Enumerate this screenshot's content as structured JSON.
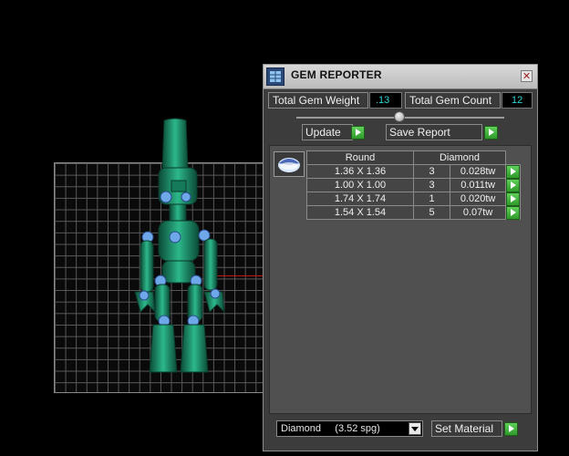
{
  "panel": {
    "title": "GEM REPORTER",
    "close_symbol": "✕",
    "total_weight_label": "Total Gem Weight",
    "total_weight_value": ".13",
    "total_count_label": "Total Gem Count",
    "total_count_value": "12",
    "update_label": "Update",
    "save_report_label": "Save Report",
    "material_select": "Diamond     (3.52 spg)",
    "set_material_label": "Set Material"
  },
  "table": {
    "headers": [
      "Round",
      "Diamond"
    ],
    "rows": [
      {
        "size": "1.36 X 1.36",
        "count": "3",
        "weight": "0.028tw"
      },
      {
        "size": "1.00 X 1.00",
        "count": "3",
        "weight": "0.011tw"
      },
      {
        "size": "1.74 X 1.74",
        "count": "1",
        "weight": "0.020tw"
      },
      {
        "size": "1.54 X 1.54",
        "count": "5",
        "weight": "0.07tw"
      }
    ]
  },
  "icons": {
    "app": "gem-reporter-icon",
    "thumb": "round-gem-icon",
    "go": "green-arrow-icon"
  },
  "colors": {
    "robot": "#1e8a66",
    "value_text": "#2fd3d3",
    "go_button": "#3fb83a",
    "axis_x": "#c01818"
  }
}
